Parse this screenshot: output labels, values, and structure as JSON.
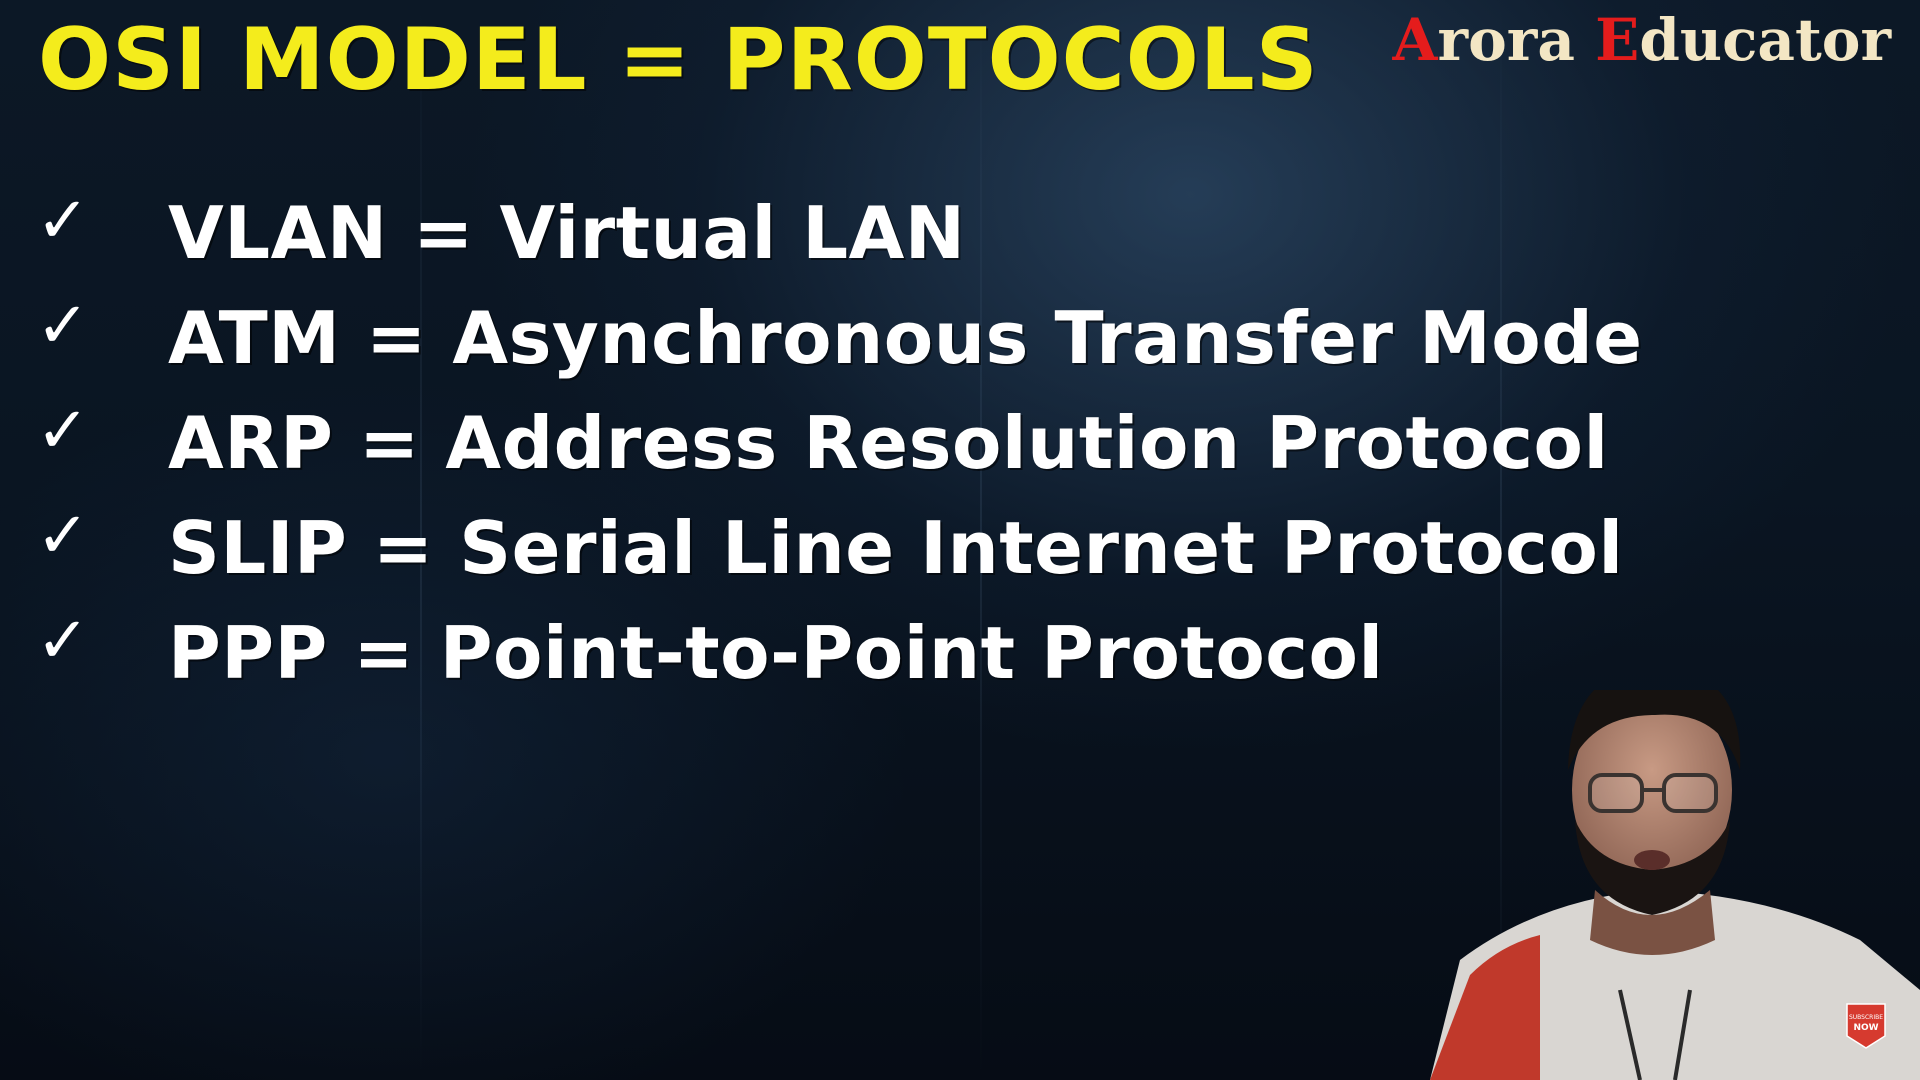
{
  "slide": {
    "title": "OSI MODEL = PROTOCOLS",
    "brand": {
      "first_initial": "A",
      "first_rest": "rora ",
      "second_initial": "E",
      "second_rest": "ducator"
    },
    "items": [
      {
        "icon": "check-icon",
        "text": "VLAN = Virtual LAN"
      },
      {
        "icon": "check-icon",
        "text": "ATM = Asynchronous Transfer Mode"
      },
      {
        "icon": "check-icon",
        "text": "ARP = Address Resolution Protocol"
      },
      {
        "icon": "check-icon",
        "text": "SLIP = Serial Line Internet Protocol"
      },
      {
        "icon": "check-icon",
        "text": "PPP = Point-to-Point Protocol"
      }
    ]
  },
  "subscribe_badge": {
    "line1": "SUBSCRIBE",
    "line2": "NOW"
  },
  "colors": {
    "title": "#f4ec1c",
    "brand_initials": "#e41c1c",
    "brand_text": "#f3e6c4",
    "item_text": "#ffffff",
    "background": "#0a1522"
  }
}
